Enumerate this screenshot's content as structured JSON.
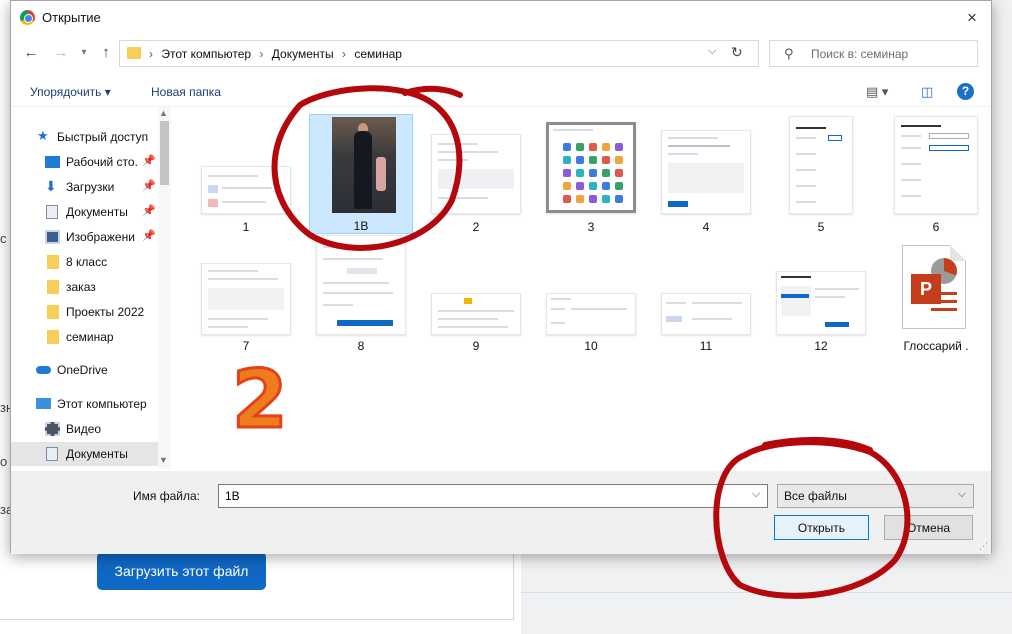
{
  "background": {
    "upload_button": "Загрузить этот файл",
    "fragments": [
      "с",
      "зн",
      "о",
      "за"
    ]
  },
  "dialog": {
    "title": "Открытие",
    "close_label": "×",
    "address": {
      "crumbs": [
        "Этот компьютер",
        "Документы",
        "семинар"
      ],
      "separator": "›"
    },
    "search_placeholder": "Поиск в: семинар",
    "toolbar": {
      "organize": "Упорядочить ▾",
      "new_folder": "Новая папка",
      "help": "?"
    },
    "sidebar": [
      {
        "label": "Быстрый доступ",
        "icon": "star-icon",
        "pinned": false
      },
      {
        "label": "Рабочий сто.",
        "icon": "desktop-icon",
        "pinned": true
      },
      {
        "label": "Загрузки",
        "icon": "download-icon",
        "pinned": true
      },
      {
        "label": "Документы",
        "icon": "documents-icon",
        "pinned": true
      },
      {
        "label": "Изображени",
        "icon": "pictures-icon",
        "pinned": true
      },
      {
        "label": "8 класс",
        "icon": "folder-icon",
        "pinned": false
      },
      {
        "label": "заказ",
        "icon": "folder-icon",
        "pinned": false
      },
      {
        "label": "Проекты 2022",
        "icon": "folder-icon",
        "pinned": false
      },
      {
        "label": "семинар",
        "icon": "folder-icon",
        "pinned": false
      },
      {
        "label": "OneDrive",
        "icon": "cloud-icon",
        "pinned": false
      },
      {
        "label": "Этот компьютер",
        "icon": "computer-icon",
        "pinned": false
      },
      {
        "label": "Видео",
        "icon": "video-icon",
        "pinned": false
      },
      {
        "label": "Документы",
        "icon": "documents-icon",
        "pinned": false,
        "selected": true
      }
    ],
    "files": [
      {
        "name": "1",
        "kind": "doc"
      },
      {
        "name": "1В",
        "kind": "photo",
        "selected": true
      },
      {
        "name": "2",
        "kind": "doc"
      },
      {
        "name": "3",
        "kind": "grid"
      },
      {
        "name": "4",
        "kind": "doc"
      },
      {
        "name": "5",
        "kind": "form"
      },
      {
        "name": "6",
        "kind": "form"
      },
      {
        "name": "7",
        "kind": "doc"
      },
      {
        "name": "8",
        "kind": "doc"
      },
      {
        "name": "9",
        "kind": "wide"
      },
      {
        "name": "10",
        "kind": "wide"
      },
      {
        "name": "11",
        "kind": "wide"
      },
      {
        "name": "12",
        "kind": "wide"
      },
      {
        "name": "Глоссарий .",
        "kind": "ppt"
      }
    ],
    "filename_label": "Имя файла:",
    "filename_value": "1В",
    "file_type": "Все файлы",
    "open_button": "Открыть",
    "cancel_button": "Отмена"
  },
  "annotation": {
    "number": "2",
    "stroke_color": "#b4080d",
    "number_color": "#ef7d1e"
  }
}
